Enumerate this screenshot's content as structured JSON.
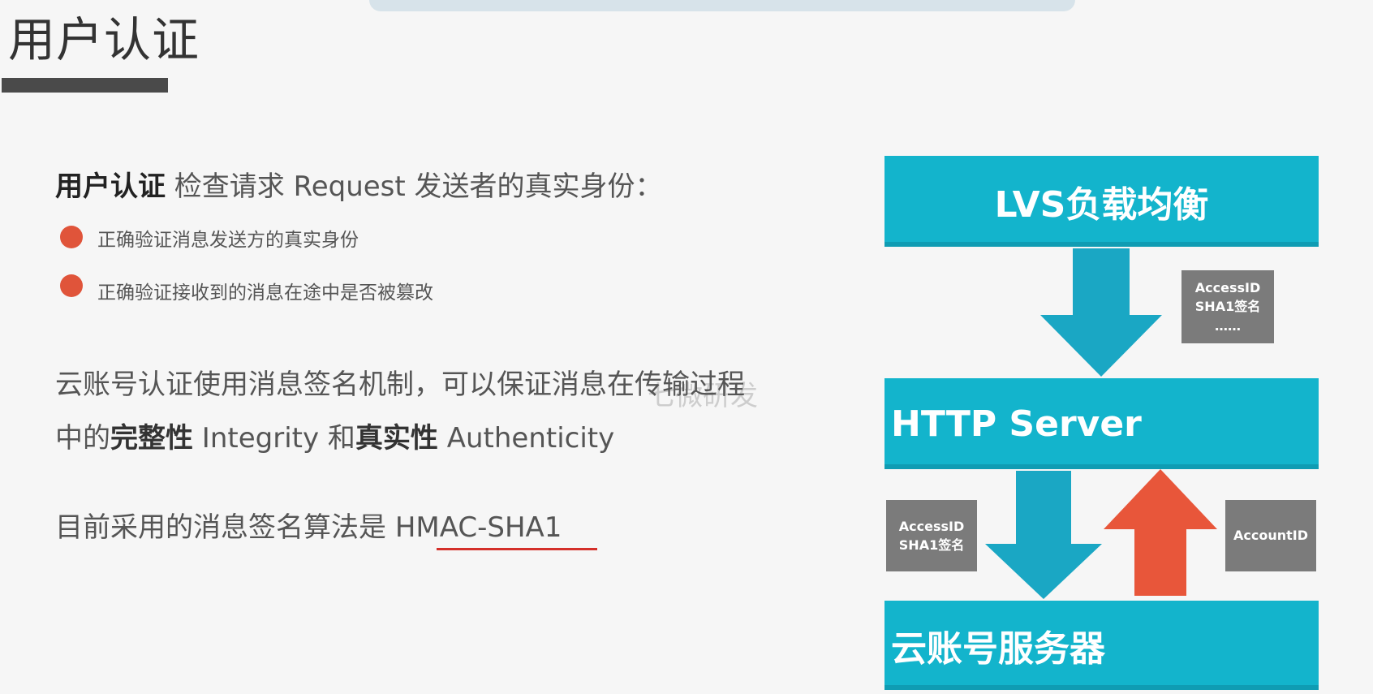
{
  "slide": {
    "title": "用户认证",
    "intro": {
      "bold": "用户认证",
      "rest": " 检查请求 Request 发送者的真实身份："
    },
    "bullets": [
      "正确验证消息发送方的真实身份",
      "正确验证接收到的消息在途中是否被篡改"
    ],
    "paragraph": {
      "line1": "云账号认证使用消息签名机制，可以保证消息在传输过程",
      "line2_a": "中的",
      "line2_b": "完整性",
      "line2_c": " Integrity 和",
      "line2_d": "真实性",
      "line2_e": " Authenticity"
    },
    "watermark": "七微研发",
    "algorithm": {
      "prefix": "目前采用的消息签名算法是 ",
      "name": "HMAC-SHA1"
    }
  },
  "diagram": {
    "lvs": "LVS负载均衡",
    "http": "HTTP Server",
    "cloud": "云账号服务器",
    "badge_top": {
      "line1": "AccessID",
      "line2": "SHA1签名",
      "line3": "……"
    },
    "badge_left": {
      "line1": "AccessID",
      "line2": "SHA1签名"
    },
    "badge_right": {
      "line1": "AccountID"
    }
  },
  "colors": {
    "accent_bullet": "#e0543a",
    "block_teal": "#13b4cc",
    "arrow_down": "#1aa7c4",
    "arrow_up": "#e8563a",
    "badge_gray": "#7b7b7b",
    "underline_red": "#d4302a"
  }
}
